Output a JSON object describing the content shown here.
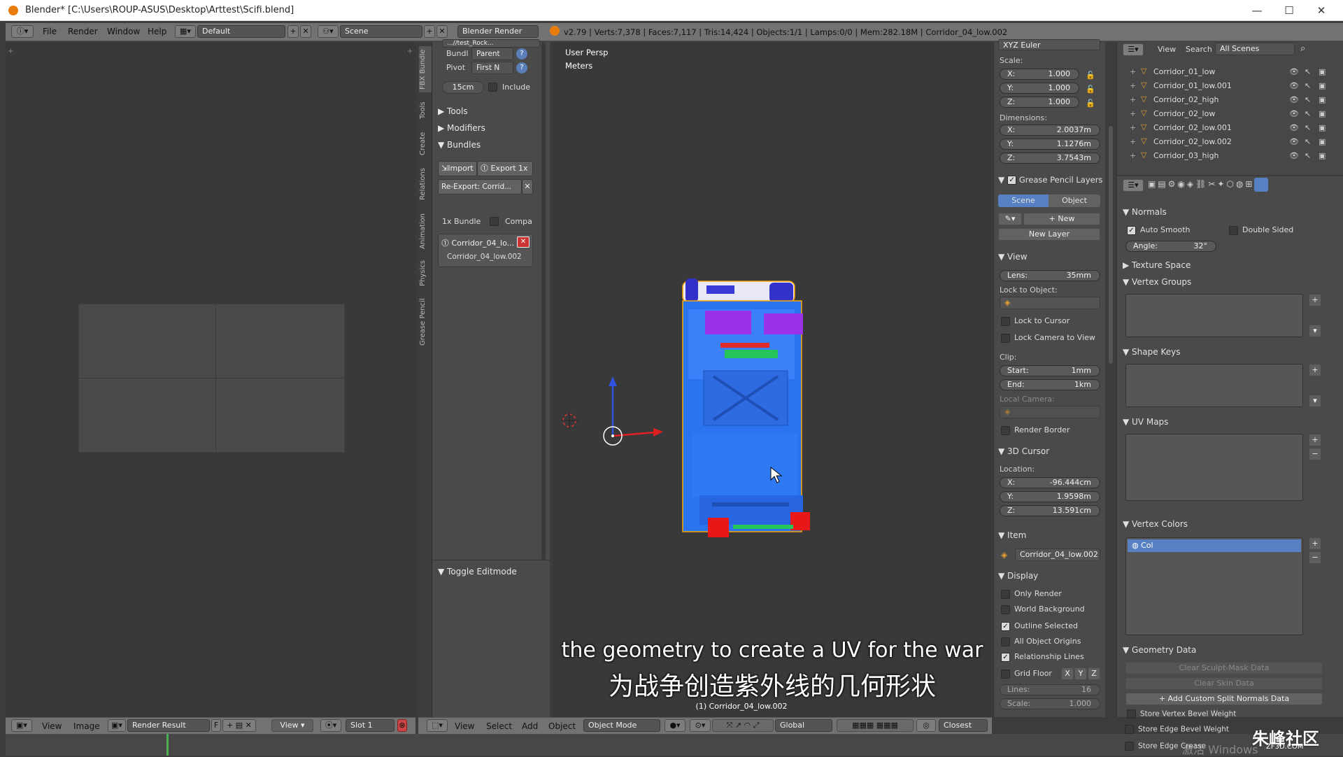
{
  "window": {
    "title": "Blender* [C:\\Users\\ROUP-ASUS\\Desktop\\Arttest\\Scifi.blend]",
    "minimize": "—",
    "maximize": "☐",
    "close": "✕"
  },
  "menubar": {
    "file": "File",
    "render": "Render",
    "window": "Window",
    "help": "Help",
    "screen": "Default",
    "scene": "Scene",
    "engine": "Blender Render",
    "stats": "v2.79 | Verts:7,378 | Faces:7,117 | Tris:14,424 | Objects:1/1 | Lamps:0/0 | Mem:282.18M | Corridor_04_low.002"
  },
  "tabs": [
    "FBX Bundle",
    "Tools",
    "Create",
    "Relations",
    "Animation",
    "Physics",
    "Grease Pencil"
  ],
  "toolshelf": {
    "top_field": "...//test_Rock...",
    "bundle_label": "Bundl",
    "bundle_value": "Parent",
    "pivot_label": "Pivot",
    "pivot_value": "First N",
    "size_value": "15cm",
    "include_label": "Include",
    "tools": "Tools",
    "modifiers": "Modifiers",
    "bundles": "Bundles",
    "import_btn": "Import",
    "export_btn": "Export 1x",
    "reexport_btn": "Re-Export: Corrid...",
    "bundle_count": "1x Bundle",
    "compa_label": "Compa",
    "bundle_name": "Corridor_04_lo...",
    "bundle_sub": "Corridor_04_low.002",
    "toggle_editmode": "Toggle Editmode"
  },
  "viewport": {
    "persp": "User Persp",
    "units": "Meters",
    "object_label": "(1) Corridor_04_low.002",
    "subtitle_en": "the geometry to create a UV for the war",
    "subtitle_zh": "为战争创造紫外线的几何形状"
  },
  "viewport_header": {
    "view": "View",
    "select": "Select",
    "add": "Add",
    "object": "Object",
    "mode": "Object Mode",
    "orientation": "Global",
    "snap": "Closest"
  },
  "image_editor_header": {
    "view": "View",
    "image": "Image",
    "image_name": "Render Result",
    "f": "F",
    "view2": "View",
    "slot": "Slot 1"
  },
  "npanel": {
    "rotation_mode": "XYZ Euler",
    "scale_label": "Scale:",
    "scale": [
      {
        "k": "X:",
        "v": "1.000"
      },
      {
        "k": "Y:",
        "v": "1.000"
      },
      {
        "k": "Z:",
        "v": "1.000"
      }
    ],
    "dimensions_label": "Dimensions:",
    "dimensions": [
      {
        "k": "X:",
        "v": "2.0037m"
      },
      {
        "k": "Y:",
        "v": "1.1276m"
      },
      {
        "k": "Z:",
        "v": "3.7543m"
      }
    ],
    "grease_pencil": "Grease Pencil Layers",
    "gp_scene": "Scene",
    "gp_object": "Object",
    "gp_new": "New",
    "gp_new_layer": "New Layer",
    "view_head": "View",
    "lens": {
      "k": "Lens:",
      "v": "35mm"
    },
    "lock_to_object": "Lock to Object:",
    "lock_cursor": "Lock to Cursor",
    "lock_camera": "Lock Camera to View",
    "clip": "Clip:",
    "clip_start": {
      "k": "Start:",
      "v": "1mm"
    },
    "clip_end": {
      "k": "End:",
      "v": "1km"
    },
    "local_camera": "Local Camera:",
    "render_border": "Render Border",
    "cursor_head": "3D Cursor",
    "location_label": "Location:",
    "cursor_loc": [
      {
        "k": "X:",
        "v": "-96.444cm"
      },
      {
        "k": "Y:",
        "v": "1.9598m"
      },
      {
        "k": "Z:",
        "v": "13.591cm"
      }
    ],
    "item_head": "Item",
    "item_name": "Corridor_04_low.002",
    "display_head": "Display",
    "display": [
      {
        "label": "Only Render",
        "on": false
      },
      {
        "label": "World Background",
        "on": false
      },
      {
        "label": "Outline Selected",
        "on": true
      },
      {
        "label": "All Object Origins",
        "on": false
      },
      {
        "label": "Relationship Lines",
        "on": true
      }
    ],
    "grid_floor": "Grid Floor",
    "axes": [
      "X",
      "Y",
      "Z"
    ],
    "lines": {
      "k": "Lines:",
      "v": "16"
    },
    "scale2": {
      "k": "Scale:",
      "v": "1.000"
    }
  },
  "outliner": {
    "view": "View",
    "search": "Search",
    "scenes": "All Scenes",
    "items": [
      "Corridor_01_low",
      "Corridor_01_low.001",
      "Corridor_02_high",
      "Corridor_02_low",
      "Corridor_02_low.001",
      "Corridor_02_low.002",
      "Corridor_03_high"
    ]
  },
  "props": {
    "normals": "Normals",
    "auto_smooth": "Auto Smooth",
    "double_sided": "Double Sided",
    "angle": {
      "k": "Angle:",
      "v": "32°"
    },
    "texture_space": "Texture Space",
    "vertex_groups": "Vertex Groups",
    "shape_keys": "Shape Keys",
    "uv_maps": "UV Maps",
    "vertex_colors": "Vertex Colors",
    "col_layer": "Col",
    "geometry_data": "Geometry Data",
    "clear_sculpt": "Clear Sculpt-Mask Data",
    "clear_skin": "Clear Skin Data",
    "add_split_normals": "Add Custom Split Normals Data",
    "store_vertex": "Store Vertex Bevel Weight",
    "store_edge": "Store Edge Bevel Weight",
    "store_edge_crease": "Store Edge Crease"
  },
  "watermark": {
    "cn": "朱峰社区",
    "en": "ZF3D.COM"
  },
  "activate_windows": "激活 Windows"
}
